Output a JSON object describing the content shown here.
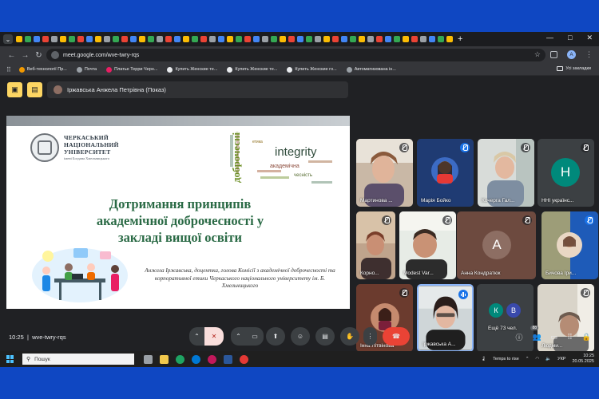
{
  "colors": {
    "accent": "#1a73e8",
    "end_call": "#ea4335",
    "slide_title": "#2a6a45",
    "desktop": "#0f47c2"
  },
  "browser": {
    "url": "meet.google.com/wve-twry-rqs",
    "bookmarks": [
      "Веб-технології Пр...",
      "Почта",
      "Платье Терри Черн...",
      "Купить Женские те...",
      "Купить Женские те...",
      "Купить Женские го...",
      "Автоматизована ін..."
    ],
    "all_bookmarks": "Усі закладки",
    "profile_initial": "A"
  },
  "meet": {
    "presenter_chip": "Іржавська Анжела Петрівна (Показ)",
    "meeting_code": "wve-twry-rqs",
    "time": "10:25",
    "people_badge": "88",
    "more_count_label": "Ещё 73 чел."
  },
  "slide": {
    "university_lines": [
      "ЧЕРКАСЬКИЙ",
      "НАЦІОНАЛЬНИЙ",
      "УНІВЕРСИТЕТ"
    ],
    "university_sub": "імені Богдана Хмельницького",
    "wordcloud_words": [
      "integrity",
      "доброчесність",
      "академічна",
      "чесність",
      "етика"
    ],
    "title_lines": [
      "Дотримання принципів",
      "академічної доброчесності у",
      "закладі вищої освіти"
    ],
    "author": "Анжела Іржавська, доцентка, голова Комісії з академічної доброчесності та корпоративної етики Черкаського національного університету ім. Б. Хмельницького"
  },
  "participants": [
    {
      "name": "Мартинова ...",
      "initial": ""
    },
    {
      "name": "Марія Бойко",
      "initial": ""
    },
    {
      "name": "Кочерга Гал...",
      "initial": ""
    },
    {
      "name": "ННІ українс...",
      "initial": "Н"
    },
    {
      "name": "Корно...",
      "initial": ""
    },
    {
      "name": "Modest Var...",
      "initial": ""
    },
    {
      "name": "Анна Кондратюк",
      "initial": "А"
    },
    {
      "name": "Бичова Іри...",
      "initial": ""
    },
    {
      "name": "Інна Літвінова",
      "initial": ""
    },
    {
      "name": "Іржавська А...",
      "initial": ""
    },
    {
      "name": "Людми...",
      "initial": ""
    }
  ],
  "more_initials": [
    "К",
    "В"
  ],
  "taskbar": {
    "search_label": "Пошук",
    "weather": "Temps to rise",
    "lang": "УКР",
    "time": "10:25",
    "date": "20.05.2025"
  }
}
